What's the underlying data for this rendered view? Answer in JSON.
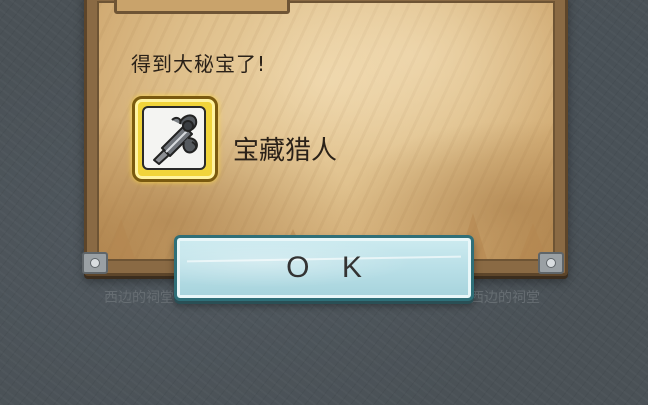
{
  "dialog": {
    "message": "得到大秘宝了!",
    "reward": {
      "icon": "treasure-hunter-sword-icon",
      "name": "宝藏猎人"
    },
    "ok_label": "O K"
  },
  "background": {
    "label_left": "西边的祠堂",
    "label_right": "西边的祠堂"
  },
  "colors": {
    "parchment": "#dfc08c",
    "frame": "#8a6a44",
    "reward_frame": "#f1d43b",
    "button": "#b7dee6",
    "button_border": "#2f6f78"
  }
}
